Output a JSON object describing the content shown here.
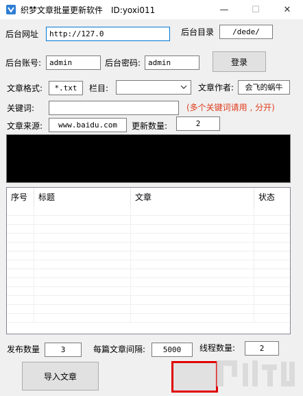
{
  "window": {
    "title": "织梦文章批量更新软件　ID:yoxi011",
    "minimize_glyph": "—",
    "maximize_glyph": "☐",
    "close_glyph": "✕"
  },
  "site": {
    "url_label": "后台网址",
    "url_value": "http://127.0",
    "dir_label": "后台目录",
    "dir_value": "/dede/",
    "account_label": "后台账号:",
    "account_value": "admin",
    "password_label": "后台密码:",
    "password_value": "admin",
    "login_button": "登录"
  },
  "article": {
    "format_label": "文章格式:",
    "format_value": "*.txt",
    "column_label": "栏目:",
    "column_value": "",
    "author_label": "文章作者:",
    "author_value": "会飞的蜗牛",
    "keywords_label": "关键词:",
    "keywords_value": "",
    "keywords_hint": "(多个关键词请用 , 分开)",
    "source_label": "文章来源:",
    "source_value": "www.baidu.com",
    "update_count_label": "更新数量:",
    "update_count_value": "2"
  },
  "table": {
    "columns": [
      "序号",
      "标题",
      "文章",
      "状态"
    ]
  },
  "bottom": {
    "publish_count_label": "发布数量",
    "publish_count_value": "3",
    "interval_label": "每篇文章间隔:",
    "interval_value": "5000",
    "threads_label": "线程数量:",
    "threads_value": "2",
    "import_button": "导入文章",
    "start_button": ""
  },
  "icons": {
    "app": "app-icon",
    "dropdown": "chevron-down-icon"
  },
  "colors": {
    "hint_red": "#e03c1e",
    "highlight_red": "#e00000",
    "focus_blue": "#0078d7",
    "log_background": "#000000"
  }
}
